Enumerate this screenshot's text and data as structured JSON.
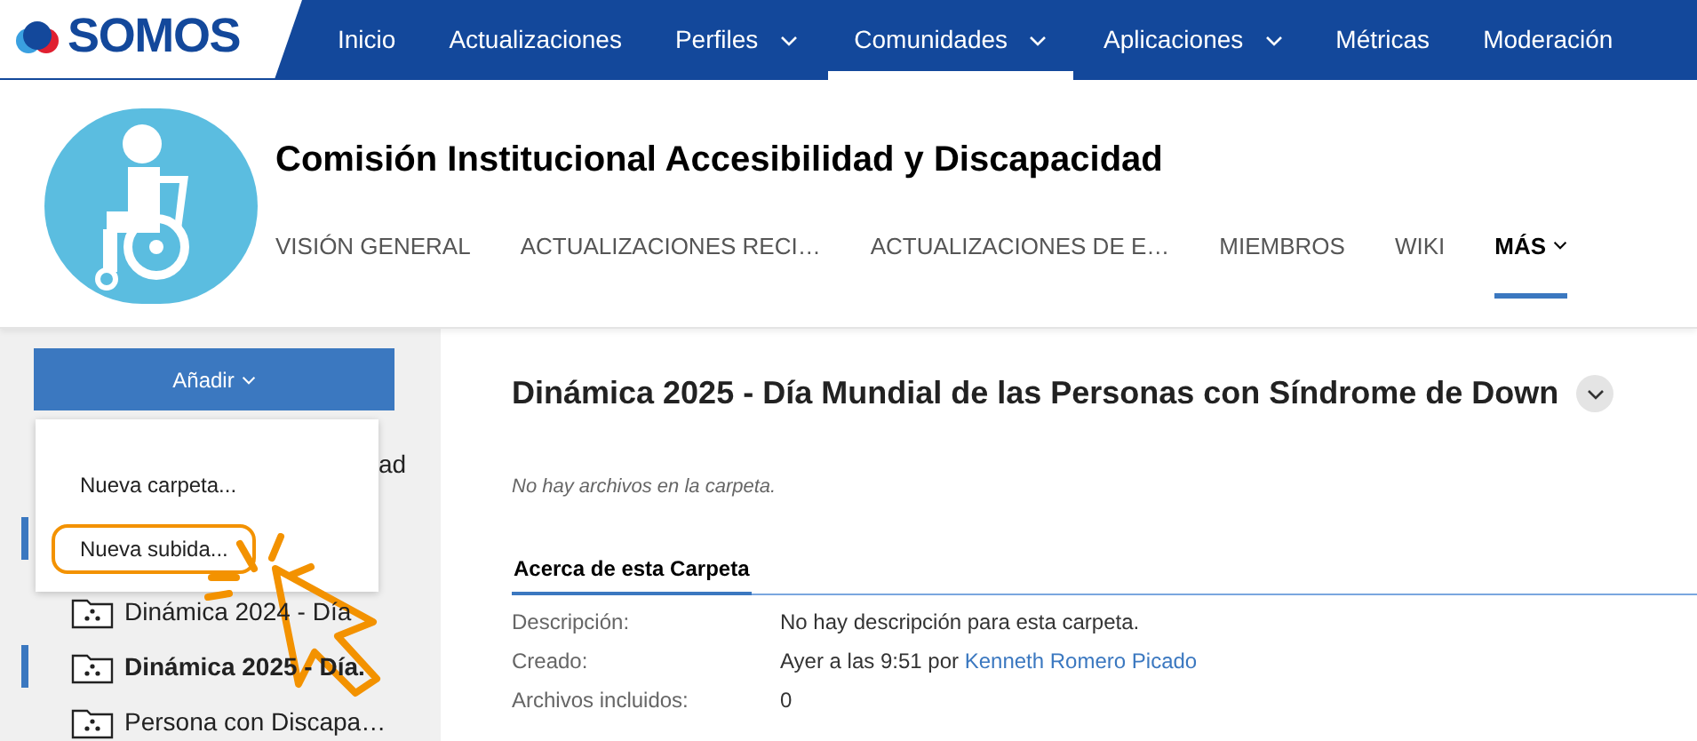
{
  "nav": {
    "logo": "SOMOS",
    "items": [
      {
        "label": "Inicio",
        "selected": false,
        "has_menu": false
      },
      {
        "label": "Actualizaciones",
        "selected": false,
        "has_menu": false
      },
      {
        "label": "Perfiles",
        "selected": false,
        "has_menu": true
      },
      {
        "label": "Comunidades",
        "selected": true,
        "has_menu": true
      },
      {
        "label": "Aplicaciones",
        "selected": false,
        "has_menu": true
      },
      {
        "label": "Métricas",
        "selected": false,
        "has_menu": false
      },
      {
        "label": "Moderación",
        "selected": false,
        "has_menu": false
      }
    ]
  },
  "community": {
    "title": "Comisión Institucional Accesibilidad y Discapacidad",
    "tabs": [
      {
        "label": "VISIÓN GENERAL",
        "selected": false,
        "has_menu": false
      },
      {
        "label": "ACTUALIZACIONES RECI…",
        "selected": false,
        "has_menu": false
      },
      {
        "label": "ACTUALIZACIONES DE E…",
        "selected": false,
        "has_menu": false
      },
      {
        "label": "MIEMBROS",
        "selected": false,
        "has_menu": false
      },
      {
        "label": "WIKI",
        "selected": false,
        "has_menu": false
      },
      {
        "label": "MÁS",
        "selected": true,
        "has_menu": true
      }
    ]
  },
  "sidebar": {
    "add_button": "Añadir",
    "menu": [
      {
        "label": "Nueva carpeta...",
        "highlighted": false
      },
      {
        "label": "Nueva subida...",
        "highlighted": true
      }
    ],
    "tree": [
      {
        "label": "ad",
        "selected": false,
        "kind": "hidden"
      },
      {
        "selected": true,
        "kind": "hidden"
      },
      {
        "label": "Dinámica 2024 - Día",
        "selected": false,
        "kind": "folder"
      },
      {
        "label": "Dinámica 2025 - Día.",
        "selected": true,
        "kind": "folder"
      },
      {
        "label": "Persona con Discapa…",
        "selected": false,
        "kind": "folder"
      }
    ]
  },
  "main": {
    "title": "Dinámica 2025 - Día Mundial de las Personas con Síndrome de Down",
    "empty_message": "No hay archivos en la carpeta.",
    "section_tab": "Acerca de esta Carpeta",
    "details": [
      {
        "label": "Descripción:",
        "value": "No hay descripción para esta carpeta."
      },
      {
        "label": "Creado:",
        "value": "Ayer a las 9:51 por ",
        "link": "Kenneth Romero Picado"
      },
      {
        "label": "Archivos incluidos:",
        "value": "0"
      }
    ]
  }
}
